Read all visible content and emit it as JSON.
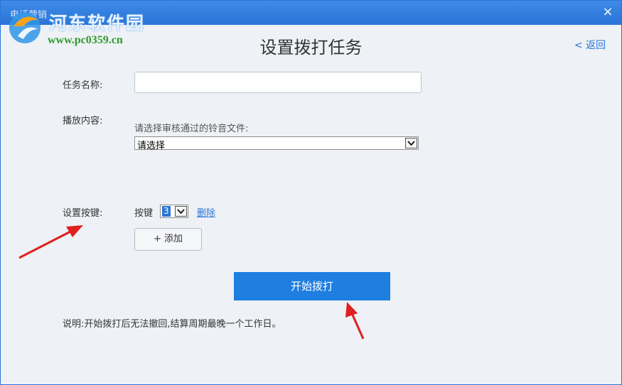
{
  "window": {
    "title": "电话营销",
    "close_icon": "×"
  },
  "watermark": {
    "site_name": "河东软件园",
    "url": "www.pc0359.cn"
  },
  "header": {
    "title": "设置拨打任务",
    "back_label": "< 返回"
  },
  "form": {
    "task_name_label": "任务名称:",
    "task_name_value": "",
    "content_label": "播放内容:",
    "content_hint": "请选择审核通过的铃音文件:",
    "content_select_value": "请选择",
    "keys_label": "设置按键:",
    "key_label": "按键",
    "key_value": "3",
    "delete_label": "删除",
    "add_label": "+ 添加",
    "start_label": "开始拨打",
    "note": "说明:开始拨打后无法撤回,结算周期最晚一个工作日。"
  },
  "colors": {
    "accent": "#1e7fe0",
    "titlebar": "#2a74d8",
    "annotation_arrow": "#e02020"
  }
}
